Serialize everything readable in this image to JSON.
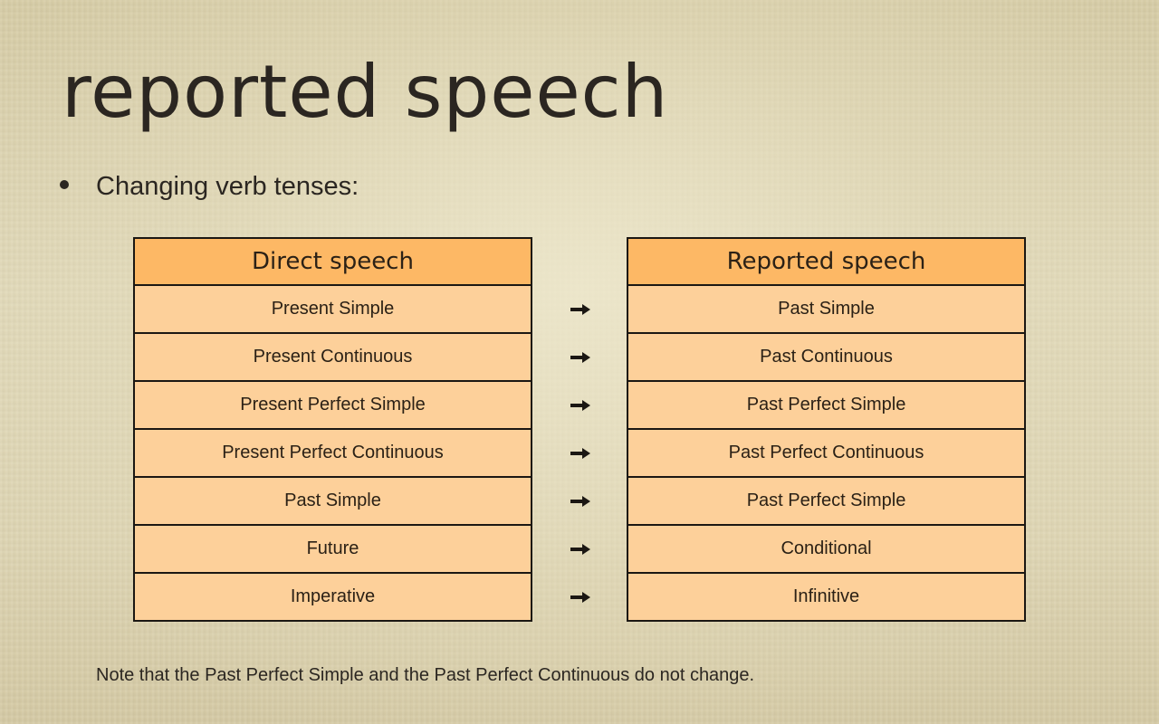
{
  "slide": {
    "title": "reported speech",
    "bullet": "Changing verb tenses:",
    "note": "Note that the Past Perfect Simple and the Past Perfect Continuous do not change."
  },
  "colors": {
    "header_fill": "#fdb865",
    "cell_fill": "#fdd09a",
    "border": "#1b1713",
    "text": "#2b2621"
  },
  "tables": {
    "direct": {
      "header": "Direct speech",
      "rows": [
        "Present Simple",
        "Present Continuous",
        "Present Perfect Simple",
        "Present Perfect Continuous",
        "Past Simple",
        "Future",
        "Imperative"
      ]
    },
    "reported": {
      "header": "Reported speech",
      "rows": [
        "Past Simple",
        "Past Continuous",
        "Past Perfect Simple",
        "Past Perfect Continuous",
        "Past Perfect Simple",
        "Conditional",
        "Infinitive"
      ]
    }
  },
  "arrow_icon": "right-arrow-icon"
}
